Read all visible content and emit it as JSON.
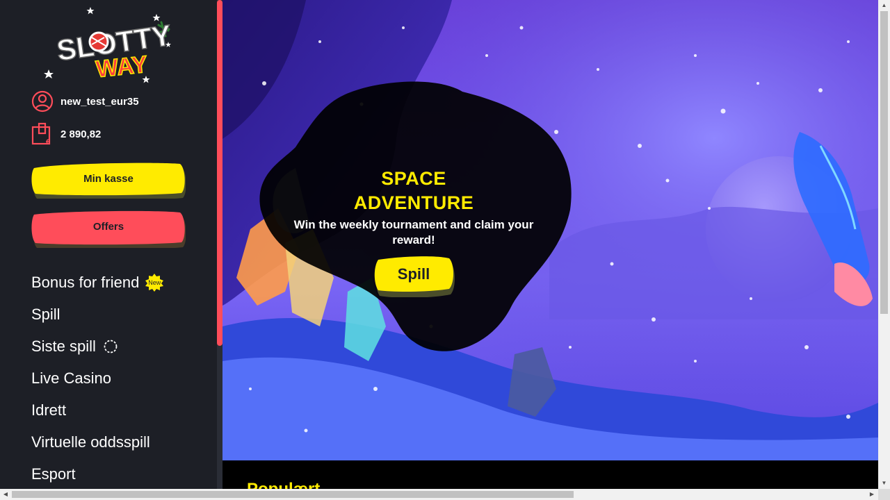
{
  "brand": {
    "logo_line1": "SLOTTY",
    "logo_line2": "WAY"
  },
  "account": {
    "username": "new_test_eur35",
    "balance": "2 890,82"
  },
  "buttons": {
    "cashier": "Min kasse",
    "offers": "Offers"
  },
  "nav": [
    {
      "label": "Bonus for friend",
      "badge": "New"
    },
    {
      "label": "Spill"
    },
    {
      "label": "Siste spill"
    },
    {
      "label": "Live Casino"
    },
    {
      "label": "Idrett"
    },
    {
      "label": "Virtuelle oddsspill"
    },
    {
      "label": "Esport"
    }
  ],
  "promo": {
    "title_line1": "SPACE",
    "title_line2": "ADVENTURE",
    "subtitle": "Win the weekly tournament and claim your reward!",
    "cta": "Spill"
  },
  "section": {
    "title": "Populært"
  },
  "colors": {
    "accent_yellow": "#ffeb00",
    "accent_red": "#ff4d5a",
    "sidebar_bg": "#1d1f26"
  },
  "icons": {
    "user": "user-circle-icon",
    "wallet": "wallet-euro-icon",
    "recent": "recent-spinner-icon",
    "badge": "new-star-badge-icon"
  }
}
